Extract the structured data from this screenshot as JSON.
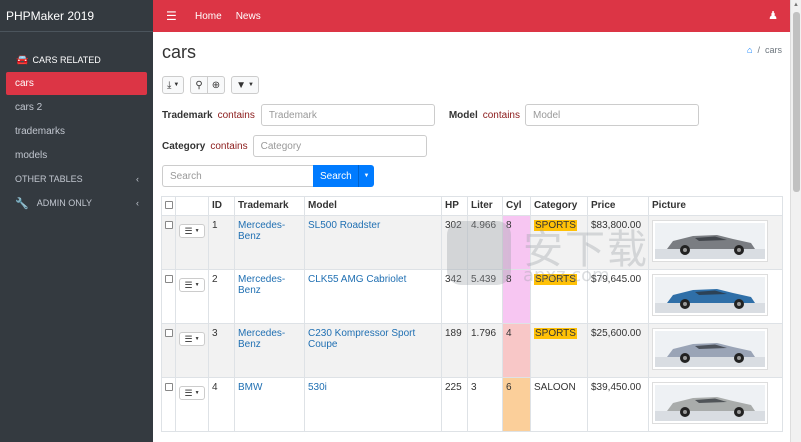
{
  "app": {
    "title": "PHPMaker 2019"
  },
  "sidebar": {
    "header": "CARS RELATED",
    "items": [
      {
        "label": "cars",
        "active": true
      },
      {
        "label": "cars 2",
        "active": false
      },
      {
        "label": "trademarks",
        "active": false
      },
      {
        "label": "models",
        "active": false
      }
    ],
    "other_tables": "OTHER TABLES",
    "admin_only": "ADMIN ONLY"
  },
  "topnav": {
    "links": [
      "Home",
      "News"
    ]
  },
  "page": {
    "title": "cars",
    "breadcrumb_current": "cars"
  },
  "filters": {
    "trademark": {
      "label": "Trademark",
      "operator": "contains",
      "placeholder": "Trademark"
    },
    "model": {
      "label": "Model",
      "operator": "contains",
      "placeholder": "Model"
    },
    "category": {
      "label": "Category",
      "operator": "contains",
      "placeholder": "Category"
    }
  },
  "search": {
    "placeholder": "Search",
    "button_label": "Search"
  },
  "table": {
    "columns": [
      "ID",
      "Trademark",
      "Model",
      "HP",
      "Liter",
      "Cyl",
      "Category",
      "Price",
      "Picture"
    ],
    "rows": [
      {
        "id": "1",
        "trademark": "Mercedes-Benz",
        "model": "SL500 Roadster",
        "hp": "302",
        "liter": "4.966",
        "cyl": "8",
        "cyl_color": "#f7c6f2",
        "category": "SPORTS",
        "highlight": true,
        "price": "$83,800.00",
        "car_color": "#7a7d82"
      },
      {
        "id": "2",
        "trademark": "Mercedes-Benz",
        "model": "CLK55 AMG Cabriolet",
        "hp": "342",
        "liter": "5.439",
        "cyl": "8",
        "cyl_color": "#f7c6f2",
        "category": "SPORTS",
        "highlight": true,
        "price": "$79,645.00",
        "car_color": "#2f6fa8"
      },
      {
        "id": "3",
        "trademark": "Mercedes-Benz",
        "model": "C230 Kompressor Sport Coupe",
        "hp": "189",
        "liter": "1.796",
        "cyl": "4",
        "cyl_color": "#f8c7c7",
        "category": "SPORTS",
        "highlight": true,
        "price": "$25,600.00",
        "car_color": "#9aa4b6"
      },
      {
        "id": "4",
        "trademark": "BMW",
        "model": "530i",
        "hp": "225",
        "liter": "3",
        "cyl": "6",
        "cyl_color": "#fbcf9a",
        "category": "SALOON",
        "highlight": false,
        "price": "$39,450.00",
        "car_color": "#a9acab"
      }
    ]
  },
  "watermark": {
    "text": "安下载",
    "sub": "anxz.com"
  }
}
